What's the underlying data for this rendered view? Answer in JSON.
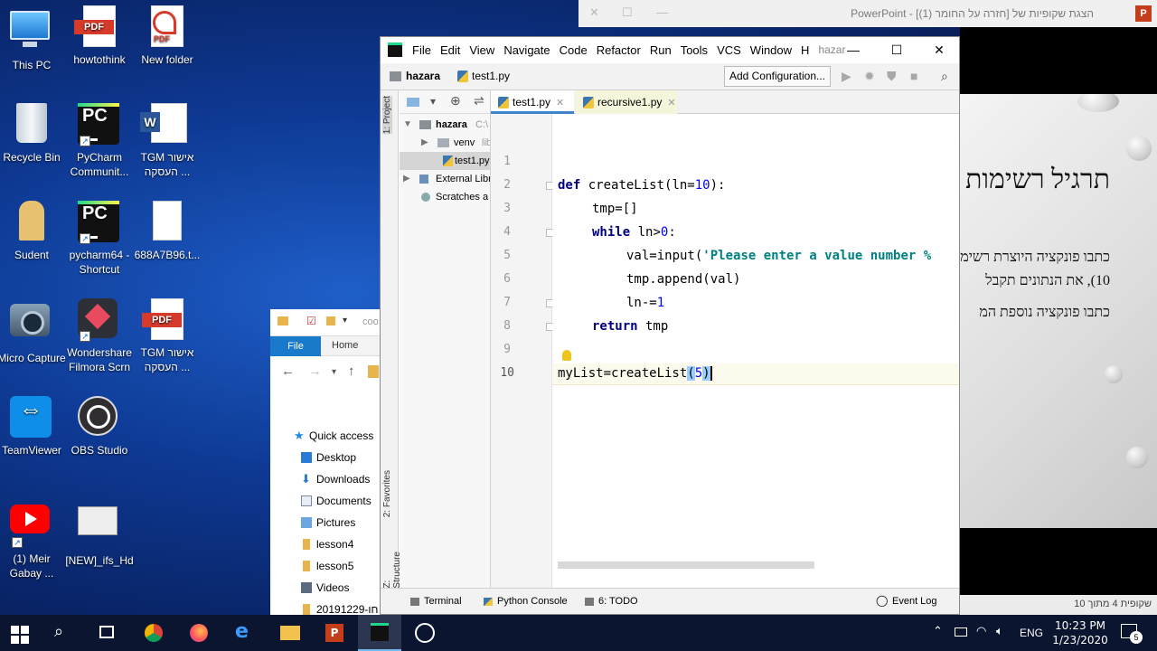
{
  "desktop": {
    "icons": [
      {
        "label": "This PC",
        "icon": "computer-icon"
      },
      {
        "label": "howtothink",
        "icon": "pdf-icon"
      },
      {
        "label": "New folder",
        "icon": "pdf-icon"
      },
      {
        "label": "Recycle Bin",
        "icon": "recycle-bin-icon"
      },
      {
        "label": "PyCharm Communit...",
        "icon": "pycharm-icon"
      },
      {
        "label": "TGM אישור העסקה ...",
        "icon": "word-icon"
      },
      {
        "label": "Sudent",
        "icon": "user-folder-icon"
      },
      {
        "label": "pycharm64 - Shortcut",
        "icon": "pycharm-icon"
      },
      {
        "label": "688A7B96.t...",
        "icon": "file-icon"
      },
      {
        "label": "Micro Capture",
        "icon": "camera-icon"
      },
      {
        "label": "Wondershare Filmora Scrn",
        "icon": "filmora-icon"
      },
      {
        "label": "TGM אישור העסקה ...",
        "icon": "pdf-icon"
      },
      {
        "label": "TeamViewer",
        "icon": "teamviewer-icon"
      },
      {
        "label": "OBS Studio",
        "icon": "obs-icon"
      },
      {
        "label": "(1) Meir Gabay ...",
        "icon": "youtube-icon"
      },
      {
        "label": "[NEW]_ifs_Hd",
        "icon": "video-file-icon"
      }
    ]
  },
  "powerpoint": {
    "window_title": "PowerPoint - [חזרה על החומר (1)] הצגת שקופיות של",
    "logo_letter": "P",
    "slide_title": "תרגיל רשימות",
    "lines": [
      "כתבו פונקציה היוצרת רשימה",
      "10), את הנתונים תקבל",
      "כתבו פונקציה נוספת המ"
    ],
    "status": "שקופית 4 מתוך 10"
  },
  "explorer": {
    "path_fragment": "coo",
    "ribbon_file": "File",
    "ribbon_home": "Home",
    "quick_access": "Quick access",
    "items": [
      "Desktop",
      "Downloads",
      "Documents",
      "Pictures",
      "lesson4",
      "lesson5",
      "Videos",
      "20191229-חו"
    ]
  },
  "pycharm": {
    "menu": [
      "File",
      "Edit",
      "View",
      "Navigate",
      "Code",
      "Refactor",
      "Run",
      "Tools",
      "VCS",
      "Window",
      "H",
      "hazar"
    ],
    "breadcrumb": [
      "hazara",
      "test1.py"
    ],
    "add_configuration": "Add Configuration...",
    "side_tabs": {
      "project": "1: Project",
      "favorites": "2: Favorites",
      "structure": "Z: Structure"
    },
    "project_tree": [
      {
        "label": "hazara",
        "suffix": "C:\\"
      },
      {
        "label": "venv",
        "suffix": "lib"
      },
      {
        "label": "test1.py",
        "suffix": ""
      },
      {
        "label": "External Libr",
        "suffix": ""
      },
      {
        "label": "Scratches a",
        "suffix": ""
      }
    ],
    "tabs": [
      {
        "label": "test1.py",
        "active": true
      },
      {
        "label": "recursive1.py",
        "active": false
      }
    ],
    "line_numbers": [
      "1",
      "2",
      "3",
      "4",
      "5",
      "6",
      "7",
      "8",
      "9",
      "10"
    ],
    "code": {
      "l2_kw": "def",
      "l2_name": " createList(ln=",
      "l2_num": "10",
      "l2_end": "):",
      "l3": "tmp=[]",
      "l4_kw": "while",
      "l4_mid": " ln>",
      "l4_num": "0",
      "l4_end": ":",
      "l5_a": "val=input(",
      "l5_str": "'Please enter a value number %",
      "l6": "tmp.append(val)",
      "l7_a": "ln-=",
      "l7_num": "1",
      "l8_kw": "return",
      "l8_end": " tmp",
      "l10_a": "myList=createList",
      "l10_open": "(",
      "l10_num": "5",
      "l10_close": ")"
    },
    "bottom_tabs": [
      "Terminal",
      "Python Console",
      "6: TODO",
      "Event Log"
    ]
  },
  "taskbar": {
    "lang": "ENG",
    "time": "10:23 PM",
    "date": "1/23/2020",
    "notifications": "5"
  }
}
